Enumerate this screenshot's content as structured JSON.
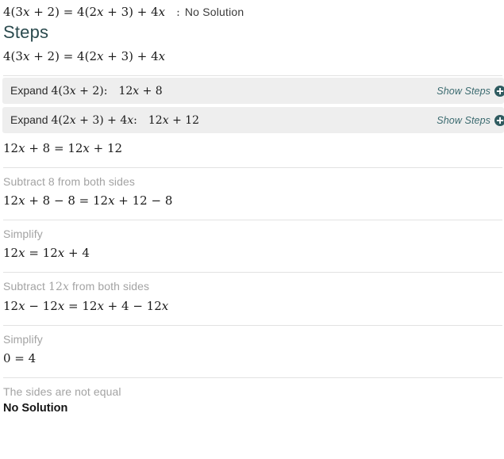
{
  "header": {
    "problem_equation": "4(3x + 2) = 4(2x + 3) + 4x",
    "separator": ":",
    "answer": "No Solution"
  },
  "steps_heading": "Steps",
  "initial_equation": "4(3x + 2) = 4(2x + 3) + 4x",
  "expand_boxes": [
    {
      "word": "Expand",
      "expression": "4(3x + 2):",
      "result": "12x + 8",
      "show_steps_label": "Show Steps",
      "icon": "plus-circle-icon"
    },
    {
      "word": "Expand",
      "expression": "4(2x + 3) + 4x:",
      "result": "12x + 12",
      "show_steps_label": "Show Steps",
      "icon": "plus-circle-icon"
    }
  ],
  "steps": [
    {
      "equation": "12x + 8 = 12x + 12"
    },
    {
      "label": "Subtract 8 from both sides",
      "equation": "12x + 8 − 8 = 12x + 12 − 8"
    },
    {
      "label": "Simplify",
      "equation": "12x = 12x + 4"
    },
    {
      "label": "Subtract 12x from both sides",
      "equation": "12x − 12x = 12x + 4 − 12x"
    },
    {
      "label": "Simplify",
      "equation": "0 = 4"
    },
    {
      "label": "The sides are not equal"
    }
  ],
  "final_answer": "No Solution",
  "colors": {
    "accent": "#2b4a4e",
    "link": "#3c6b70",
    "muted_text": "#a3a3a3",
    "box_background": "#eeeeee",
    "divider": "#e2e2e2",
    "math_text": "#1a1a1a"
  }
}
